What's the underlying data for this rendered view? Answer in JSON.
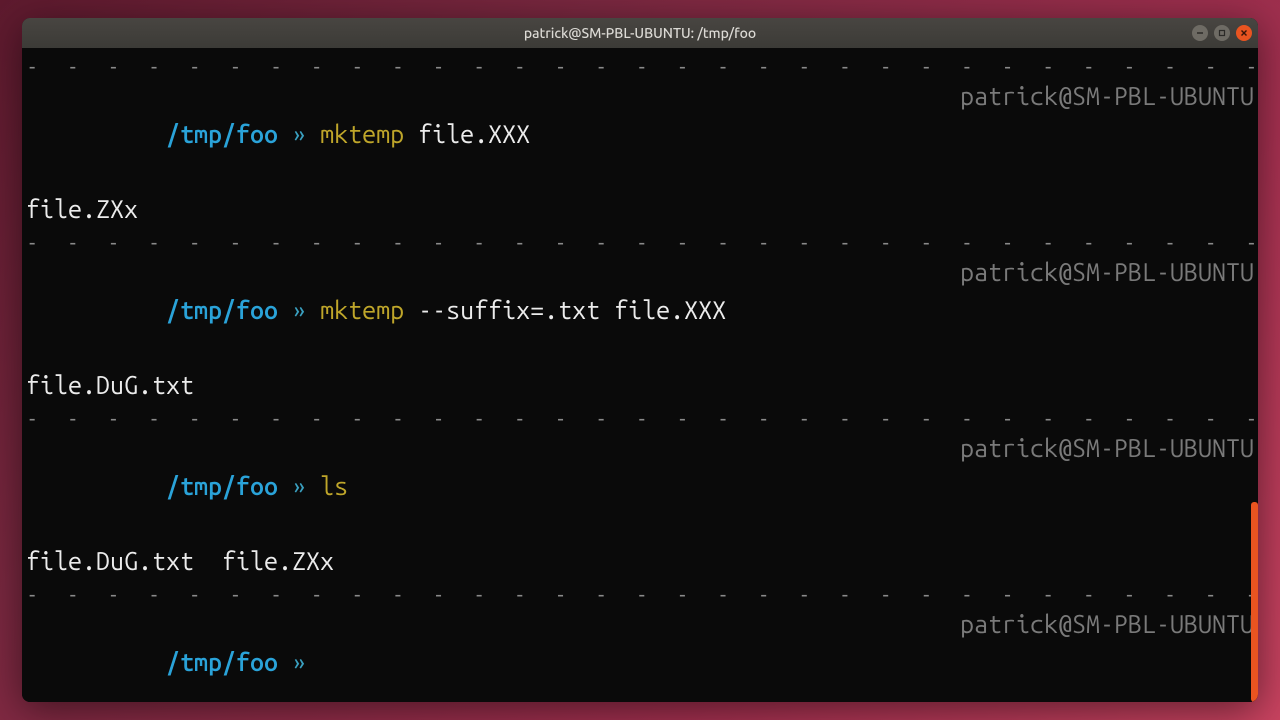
{
  "window": {
    "title": "patrick@SM-PBL-UBUNTU: /tmp/foo"
  },
  "host": "patrick@SM-PBL-UBUNTU",
  "cwd": "/tmp/foo",
  "prompt_symbol": "»",
  "divider": "- - - - - - - - - - - - - - - - - - - - - - - - - - - - - - - - - - - - - - - - - - - - - - - - - - - - - - - - - - - - - - - - - - - - - - - - - - - - - - - -",
  "entries": [
    {
      "cmd": "mktemp",
      "args": "file.XXX",
      "output": "file.ZXx"
    },
    {
      "cmd": "mktemp",
      "args": "--suffix=.txt file.XXX",
      "output": "file.DuG.txt"
    },
    {
      "cmd": "ls",
      "args": "",
      "output": "file.DuG.txt  file.ZXx"
    }
  ],
  "current": {
    "cmd": "",
    "args": ""
  }
}
